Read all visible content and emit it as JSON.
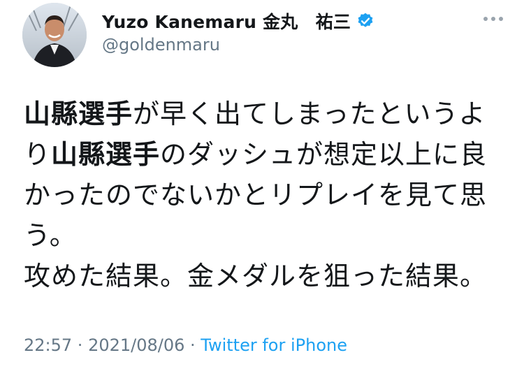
{
  "author": {
    "display_name": "Yuzo Kanemaru 金丸　祐三",
    "handle": "@goldenmaru",
    "verified": true,
    "avatar_icon": "profile-photo"
  },
  "more_icon": "ellipsis-icon",
  "tweet": {
    "lines": [
      {
        "bold": "山縣選手",
        "rest": "が早く出てしまったというよ"
      },
      {
        "pre": "り",
        "bold": "山縣選手",
        "rest": "のダッシュが想定以上に良"
      },
      {
        "rest": "かったのでないかとリプレイを見て思"
      },
      {
        "rest": "う。"
      },
      {
        "rest": "攻めた結果。金メダルを狙った結果。"
      }
    ]
  },
  "meta": {
    "time": "22:57",
    "separator": " · ",
    "date": "2021/08/06",
    "source": "Twitter for iPhone"
  },
  "colors": {
    "text": "#14171a",
    "secondary": "#657786",
    "link": "#1da1f2",
    "verified_badge": "#1da1f2"
  }
}
